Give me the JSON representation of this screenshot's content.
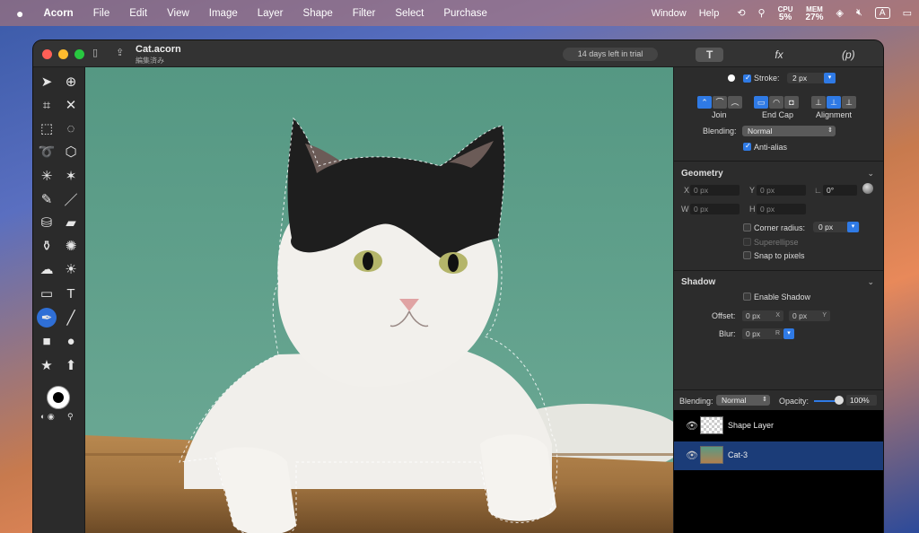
{
  "menubar": {
    "apple": "",
    "app": "Acorn",
    "items": [
      "File",
      "Edit",
      "View",
      "Image",
      "Layer",
      "Shape",
      "Filter",
      "Select",
      "Purchase"
    ],
    "right": [
      "Window",
      "Help"
    ],
    "cpu_label": "CPU",
    "cpu_value": "5%",
    "mem_label": "MEM",
    "mem_value": "27%",
    "input_badge": "A"
  },
  "window": {
    "title": "Cat.acorn",
    "subtitle": "編集済み",
    "trial": "14 days left in trial",
    "panel_tabs": [
      "T",
      "fx",
      "(p)"
    ]
  },
  "stroke": {
    "label": "Stroke:",
    "width": "2 px",
    "join_label": "Join",
    "endcap_label": "End Cap",
    "alignment_label": "Alignment",
    "blending_label": "Blending:",
    "blending_value": "Normal",
    "antialias_label": "Anti-alias"
  },
  "geometry": {
    "header": "Geometry",
    "x_label": "X",
    "x_value": "0 px",
    "y_label": "Y",
    "y_value": "0 px",
    "rot_value": "0°",
    "w_label": "W",
    "w_value": "0 px",
    "h_label": "H",
    "h_value": "0 px",
    "corner_label": "Corner radius:",
    "corner_value": "0 px",
    "superellipse_label": "Superellipse",
    "snap_label": "Snap to pixels"
  },
  "shadow": {
    "header": "Shadow",
    "enable_label": "Enable Shadow",
    "offset_label": "Offset:",
    "offset_x": "0 px",
    "x_axis": "X",
    "offset_y": "0 px",
    "y_axis": "Y",
    "blur_label": "Blur:",
    "blur_value": "0 px",
    "blur_unit": "R"
  },
  "layers": {
    "blending_label": "Blending:",
    "blending_value": "Normal",
    "opacity_label": "Opacity:",
    "opacity_value": "100%",
    "items": [
      {
        "name": "Shape Layer"
      },
      {
        "name": "Cat-3"
      }
    ]
  },
  "colors": {
    "accent": "#2f7ae5",
    "canvas_bg": "#62a38a",
    "selected_layer": "#1b3c78"
  }
}
